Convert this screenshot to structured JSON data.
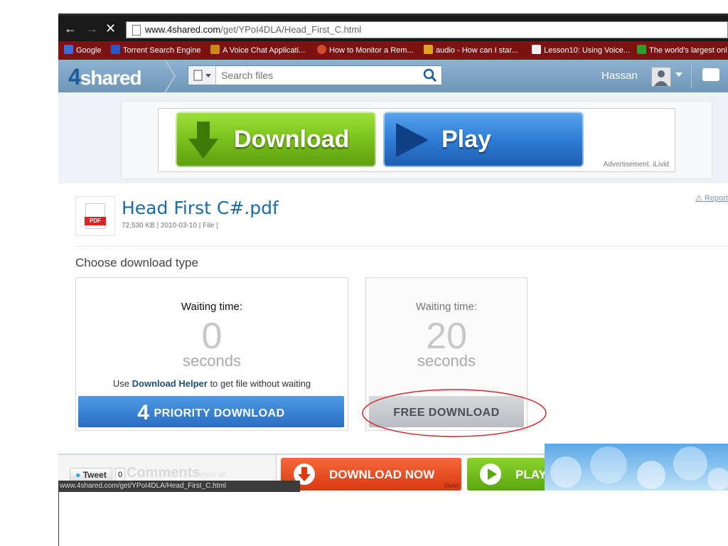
{
  "browser": {
    "url_host": "www.4shared.com",
    "url_path": "/get/YPoI4DLA/Head_First_C.html",
    "bookmarks": [
      {
        "label": "Google",
        "color": "#3b6fd8"
      },
      {
        "label": "Torrent Search Engine",
        "color": "#2a57c9"
      },
      {
        "label": "A Voice Chat Applicati...",
        "color": "#c98a1a"
      },
      {
        "label": "How to Monitor a Rem...",
        "color": "#d04a2c"
      },
      {
        "label": "audio - How can I star...",
        "color": "#e0a020"
      },
      {
        "label": "Lesson10: Using Voice...",
        "color": "#eeeeee"
      },
      {
        "label": "The world's largest onl",
        "color": "#2aa02a"
      }
    ],
    "status_url": "www.4shared.com/get/YPoI4DLA/Head_First_C.html"
  },
  "site": {
    "logo_four": "4",
    "logo_rest": "shared",
    "search_placeholder": "Search files",
    "username": "Hassan"
  },
  "ad": {
    "download_label": "Download",
    "play_label": "Play",
    "advert_text": "Advertisement. iLivid"
  },
  "file": {
    "icon_tag": "PDF",
    "name": "Head First C#.pdf",
    "meta": "72,530 KB | 2010-03-10 | File |",
    "report": "Report"
  },
  "download": {
    "choose_title": "Choose download type",
    "priority": {
      "waiting_label": "Waiting time:",
      "seconds": "0",
      "seconds_label": "seconds",
      "helper_prefix": "Use ",
      "helper_bold": "Download Helper",
      "helper_suffix": " to get file without waiting",
      "button_num": "4",
      "button_label": "PRIORITY DOWNLOAD"
    },
    "free": {
      "waiting_label": "Waiting time:",
      "seconds": "20",
      "seconds_label": "seconds",
      "button_label": "FREE DOWNLOAD"
    }
  },
  "bottom": {
    "tweet_label": "Tweet",
    "tweet_count": "0",
    "comments_title": "Comments",
    "view_all": "View all",
    "download_now": "DOWNLOAD NOW",
    "play_now": "PLAY NOW",
    "ilivid": "ilivid"
  }
}
